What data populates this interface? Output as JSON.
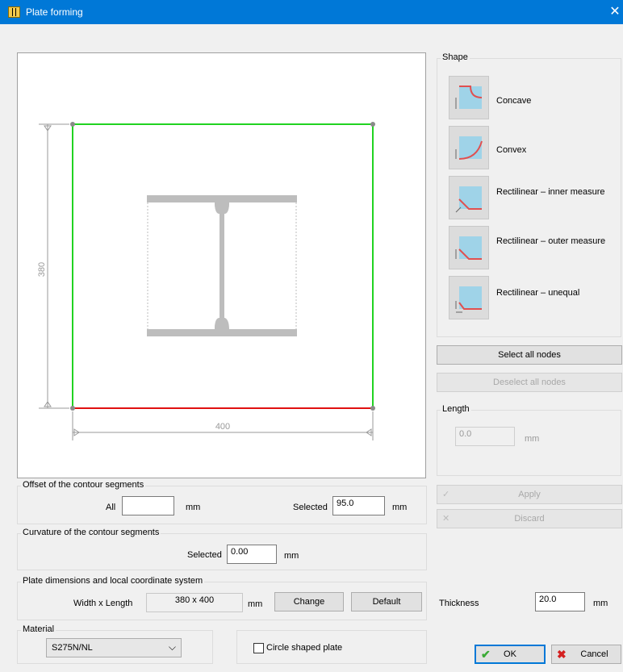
{
  "window": {
    "title": "Plate forming",
    "close_glyph": "✕"
  },
  "drawing": {
    "dim_vertical": "380",
    "dim_horizontal": "400"
  },
  "shape": {
    "legend": "Shape",
    "items": [
      {
        "label": "Concave",
        "icon": "concave-shape-icon"
      },
      {
        "label": "Convex",
        "icon": "convex-shape-icon"
      },
      {
        "label": "Rectilinear – inner measure",
        "icon": "rectilinear-inner-icon"
      },
      {
        "label": "Rectilinear – outer measure",
        "icon": "rectilinear-outer-icon"
      },
      {
        "label": "Rectilinear – unequal",
        "icon": "rectilinear-unequal-icon"
      }
    ]
  },
  "nodes": {
    "select_all": "Select all nodes",
    "deselect_all": "Deselect all nodes"
  },
  "length": {
    "legend": "Length",
    "value": "0.0",
    "unit": "mm"
  },
  "actions": {
    "apply": "Apply",
    "discard": "Discard"
  },
  "offset": {
    "legend": "Offset of the contour segments",
    "all_label": "All",
    "all_value": "",
    "all_unit": "mm",
    "selected_label": "Selected",
    "selected_value": "95.0",
    "selected_unit": "mm"
  },
  "curvature": {
    "legend": "Curvature of the contour segments",
    "selected_label": "Selected",
    "selected_value": "0.00",
    "unit": "mm"
  },
  "plate_dims": {
    "legend": "Plate dimensions and local coordinate system",
    "label": "Width x Length",
    "value": "380 x 400",
    "unit": "mm",
    "change": "Change",
    "default": "Default"
  },
  "thickness": {
    "label": "Thickness",
    "value": "20.0",
    "unit": "mm"
  },
  "material": {
    "legend": "Material",
    "value": "S275N/NL"
  },
  "circle_plate": {
    "label": "Circle shaped plate",
    "checked": false
  },
  "footer": {
    "ok": "OK",
    "cancel": "Cancel"
  },
  "colors": {
    "titlebar": "#0078d7",
    "contour_green": "#21d321",
    "contour_red": "#e01010",
    "section_gray": "#bdbdbd"
  }
}
